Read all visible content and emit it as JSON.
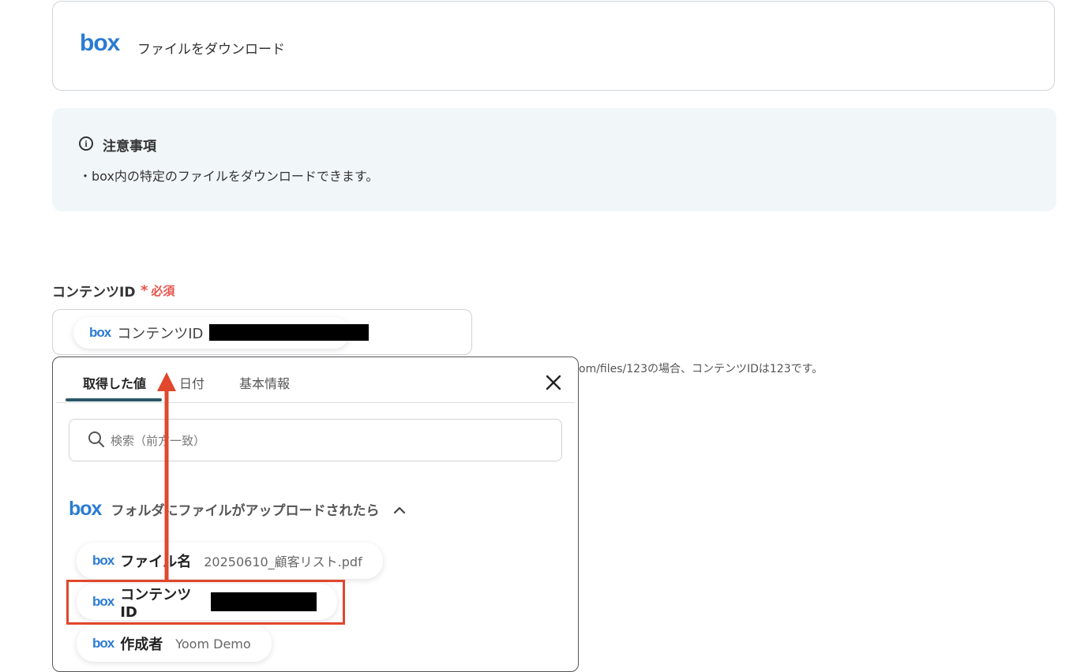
{
  "action_card": {
    "logo": "box",
    "title": "ファイルをダウンロード"
  },
  "notice": {
    "heading": "注意事項",
    "body": "・box内の特定のファイルをダウンロードできます。"
  },
  "field": {
    "label": "コンテンツID",
    "required_star": "*",
    "required_text": "必須",
    "chip_logo": "box",
    "chip_label": "コンテンツID",
    "helper_text": "om/files/123の場合、コンテンツIDは123です。"
  },
  "popup": {
    "tabs": [
      {
        "label": "取得した値",
        "active": true
      },
      {
        "label": "日付",
        "active": false
      },
      {
        "label": "基本情報",
        "active": false
      }
    ],
    "search_placeholder": "検索（前方一致）",
    "group": {
      "logo": "box",
      "label": "フォルダにファイルがアップロードされたら"
    },
    "items": [
      {
        "logo": "box",
        "key": "ファイル名",
        "value": "20250610_顧客リスト.pdf"
      },
      {
        "logo": "box",
        "key": "コンテンツID",
        "value": ""
      },
      {
        "logo": "box",
        "key": "作成者",
        "value": "Yoom Demo"
      }
    ]
  },
  "colors": {
    "box_brand": "#2a7bd3",
    "required": "#e5534b",
    "annotation": "#e0472c",
    "tab_active": "#2b5766",
    "notice_bg": "#f1f7f8"
  }
}
